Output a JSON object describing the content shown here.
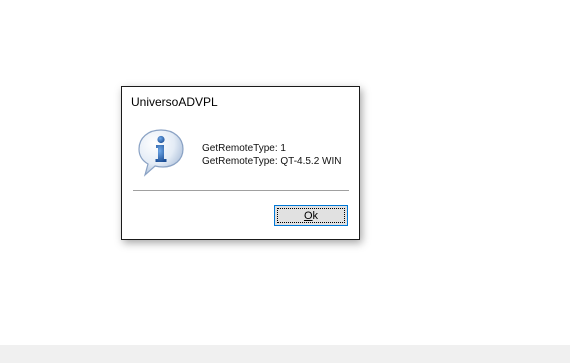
{
  "dialog": {
    "title": "UniversoADVPL",
    "messages": [
      "GetRemoteType: 1",
      "GetRemoteType: QT-4.5.2 WIN"
    ],
    "icon": "information-icon",
    "ok_button": {
      "mnemonic": "O",
      "rest": "k"
    }
  },
  "colors": {
    "button_focus_border": "#0078d7",
    "icon_blue": "#2f6fbf"
  }
}
